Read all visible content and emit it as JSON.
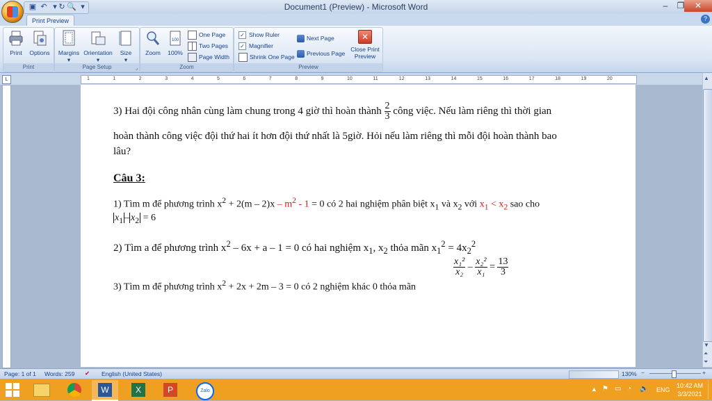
{
  "window": {
    "title": "Document1 (Preview) - Microsoft Word",
    "minimize": "–",
    "maximize": "❐",
    "close": "✕"
  },
  "ribbon": {
    "tab": "Print Preview",
    "help": "?",
    "groups": {
      "print": {
        "label": "Print",
        "print": "Print",
        "options": "Options"
      },
      "page_setup": {
        "label": "Page Setup",
        "margins": "Margins",
        "orientation": "Orientation",
        "size": "Size"
      },
      "zoom": {
        "label": "Zoom",
        "zoom": "Zoom",
        "hundred": "100%",
        "one_page": "One Page",
        "two_pages": "Two Pages",
        "page_width": "Page Width"
      },
      "preview": {
        "label": "Preview",
        "show_ruler": "Show Ruler",
        "magnifier": "Magnifier",
        "shrink": "Shrink One Page",
        "next_page": "Next Page",
        "previous_page": "Previous Page",
        "close_print": "Close Print",
        "preview_word": "Preview"
      }
    }
  },
  "ruler": {
    "toggle": "L",
    "labels": [
      "1",
      "1",
      "2",
      "3",
      "4",
      "5",
      "6",
      "7",
      "8",
      "9",
      "10",
      "11",
      "12",
      "13",
      "14",
      "15",
      "16",
      "17",
      "18",
      "19",
      "20"
    ]
  },
  "document": {
    "q3_line1_a": "3) Hai đội công nhân cùng làm chung trong 4 giờ thì hoàn thành",
    "q3_frac_num": "2",
    "q3_frac_den": "3",
    "q3_line1_b": "công việc. Nếu làm riêng thì thời gian",
    "q3_line2": "hoàn thành công việc đội thứ hai ít hơn đội thứ nhất là 5giờ. Hỏi nếu làm riêng thì mỗi đội hoàn thành bao",
    "q3_line3": "lâu?",
    "heading": "Câu 3:",
    "p1_a": "1)  Tìm m để phương trình  x",
    "p1_b": " + 2(m – 2)x ",
    "p1_red1": "– m",
    "p1_red1b": " - 1",
    "p1_c": " = 0 có 2 hai nghiệm phân biệt x",
    "p1_d": " và x",
    "p1_e": " với ",
    "p1_red2": "x",
    "p1_red2b": " < x",
    "p1_f": " sao cho",
    "p1_line2_x1": "x",
    "p1_line2_minus": "–",
    "p1_line2_x2": "x",
    "p1_line2_eq": " = 6",
    "p2_a": "2) Tìm a  để phương trình x",
    "p2_b": " – 6x + a – 1 = 0 có hai nghiệm x",
    "p2_c": ", x",
    "p2_d": " thỏa mãn x",
    "p2_e": " = 4x",
    "p3_a": "3) Tìm m để phương trình x",
    "p3_b": " + 2x + 2m – 3 = 0 có 2 nghiệm khác 0 thỏa mãn",
    "p3_f1_num": "x₁²",
    "p3_f1_den": "x₂",
    "p3_minus": "–",
    "p3_f2_num": "x₂²",
    "p3_f2_den": "x₁",
    "p3_eq": "=",
    "p3_f3_num": "13",
    "p3_f3_den": "3",
    "sup2": "2",
    "sub1": "1",
    "sub2": "2"
  },
  "statusbar": {
    "page": "Page: 1 of 1",
    "words": "Words: 259",
    "language": "English (United States)",
    "zoom": "130%",
    "zoom_minus": "−",
    "zoom_plus": "+"
  },
  "taskbar": {
    "language": "ENG",
    "time": "10:42 AM",
    "date": "3/3/2021",
    "zalo": "Zalo"
  }
}
